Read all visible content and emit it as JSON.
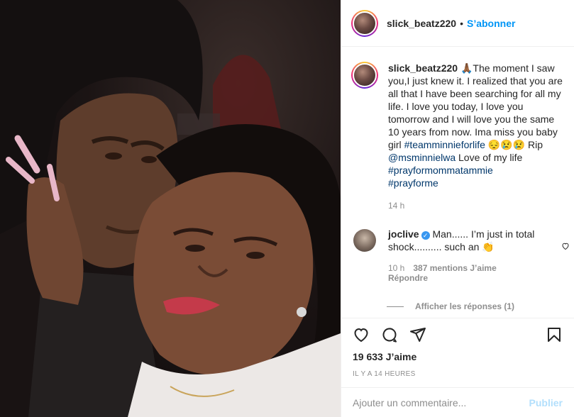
{
  "header": {
    "username": "slick_beatz220",
    "separator": "•",
    "follow_label": "S’abonner"
  },
  "caption": {
    "username": "slick_beatz220",
    "text_1": "🙏🏾The moment I saw you,I just knew it. I realized that you are all that I have been searching for all my life. I love you today, I love you tomorrow and I will love you the same 10 years from now. Ima miss you baby girl ",
    "hashtag_1": "#teamminnieforlife",
    "text_2": " 😔😢😢 Rip ",
    "mention_1": "@msminnielwa",
    "text_3": " Love of my life ",
    "hashtag_2": "#prayformommatammie",
    "hashtag_3": "#prayforme",
    "time": "14 h"
  },
  "comment": {
    "username": "joclive",
    "verified_icon": "✓",
    "text": "Man...... I’m just in total shock.......... such an 👏",
    "time": "10 h",
    "likes": "387 mentions J’aime",
    "reply_label": "Répondre",
    "view_replies_label": "Afficher les réponses (1)"
  },
  "actions": {
    "likes_count": "19 633 J’aime",
    "timestamp": "IL Y A 14 HEURES"
  },
  "add_comment": {
    "placeholder": "Ajouter un commentaire...",
    "post_label": "Publier"
  },
  "colors": {
    "accent": "#0095f6",
    "hashtag": "#00376b",
    "muted": "#8e8e8e",
    "post_disabled": "#b2dffc"
  }
}
